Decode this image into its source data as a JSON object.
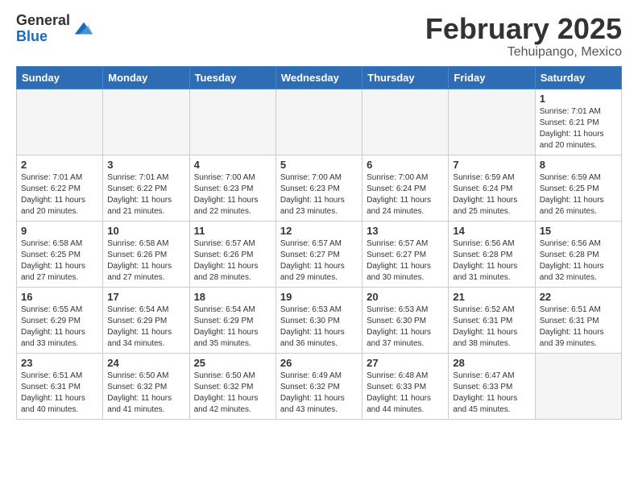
{
  "header": {
    "logo_general": "General",
    "logo_blue": "Blue",
    "month_title": "February 2025",
    "location": "Tehuipango, Mexico"
  },
  "days_of_week": [
    "Sunday",
    "Monday",
    "Tuesday",
    "Wednesday",
    "Thursday",
    "Friday",
    "Saturday"
  ],
  "weeks": [
    [
      {
        "num": "",
        "info": ""
      },
      {
        "num": "",
        "info": ""
      },
      {
        "num": "",
        "info": ""
      },
      {
        "num": "",
        "info": ""
      },
      {
        "num": "",
        "info": ""
      },
      {
        "num": "",
        "info": ""
      },
      {
        "num": "1",
        "info": "Sunrise: 7:01 AM\nSunset: 6:21 PM\nDaylight: 11 hours\nand 20 minutes."
      }
    ],
    [
      {
        "num": "2",
        "info": "Sunrise: 7:01 AM\nSunset: 6:22 PM\nDaylight: 11 hours\nand 20 minutes."
      },
      {
        "num": "3",
        "info": "Sunrise: 7:01 AM\nSunset: 6:22 PM\nDaylight: 11 hours\nand 21 minutes."
      },
      {
        "num": "4",
        "info": "Sunrise: 7:00 AM\nSunset: 6:23 PM\nDaylight: 11 hours\nand 22 minutes."
      },
      {
        "num": "5",
        "info": "Sunrise: 7:00 AM\nSunset: 6:23 PM\nDaylight: 11 hours\nand 23 minutes."
      },
      {
        "num": "6",
        "info": "Sunrise: 7:00 AM\nSunset: 6:24 PM\nDaylight: 11 hours\nand 24 minutes."
      },
      {
        "num": "7",
        "info": "Sunrise: 6:59 AM\nSunset: 6:24 PM\nDaylight: 11 hours\nand 25 minutes."
      },
      {
        "num": "8",
        "info": "Sunrise: 6:59 AM\nSunset: 6:25 PM\nDaylight: 11 hours\nand 26 minutes."
      }
    ],
    [
      {
        "num": "9",
        "info": "Sunrise: 6:58 AM\nSunset: 6:25 PM\nDaylight: 11 hours\nand 27 minutes."
      },
      {
        "num": "10",
        "info": "Sunrise: 6:58 AM\nSunset: 6:26 PM\nDaylight: 11 hours\nand 27 minutes."
      },
      {
        "num": "11",
        "info": "Sunrise: 6:57 AM\nSunset: 6:26 PM\nDaylight: 11 hours\nand 28 minutes."
      },
      {
        "num": "12",
        "info": "Sunrise: 6:57 AM\nSunset: 6:27 PM\nDaylight: 11 hours\nand 29 minutes."
      },
      {
        "num": "13",
        "info": "Sunrise: 6:57 AM\nSunset: 6:27 PM\nDaylight: 11 hours\nand 30 minutes."
      },
      {
        "num": "14",
        "info": "Sunrise: 6:56 AM\nSunset: 6:28 PM\nDaylight: 11 hours\nand 31 minutes."
      },
      {
        "num": "15",
        "info": "Sunrise: 6:56 AM\nSunset: 6:28 PM\nDaylight: 11 hours\nand 32 minutes."
      }
    ],
    [
      {
        "num": "16",
        "info": "Sunrise: 6:55 AM\nSunset: 6:29 PM\nDaylight: 11 hours\nand 33 minutes."
      },
      {
        "num": "17",
        "info": "Sunrise: 6:54 AM\nSunset: 6:29 PM\nDaylight: 11 hours\nand 34 minutes."
      },
      {
        "num": "18",
        "info": "Sunrise: 6:54 AM\nSunset: 6:29 PM\nDaylight: 11 hours\nand 35 minutes."
      },
      {
        "num": "19",
        "info": "Sunrise: 6:53 AM\nSunset: 6:30 PM\nDaylight: 11 hours\nand 36 minutes."
      },
      {
        "num": "20",
        "info": "Sunrise: 6:53 AM\nSunset: 6:30 PM\nDaylight: 11 hours\nand 37 minutes."
      },
      {
        "num": "21",
        "info": "Sunrise: 6:52 AM\nSunset: 6:31 PM\nDaylight: 11 hours\nand 38 minutes."
      },
      {
        "num": "22",
        "info": "Sunrise: 6:51 AM\nSunset: 6:31 PM\nDaylight: 11 hours\nand 39 minutes."
      }
    ],
    [
      {
        "num": "23",
        "info": "Sunrise: 6:51 AM\nSunset: 6:31 PM\nDaylight: 11 hours\nand 40 minutes."
      },
      {
        "num": "24",
        "info": "Sunrise: 6:50 AM\nSunset: 6:32 PM\nDaylight: 11 hours\nand 41 minutes."
      },
      {
        "num": "25",
        "info": "Sunrise: 6:50 AM\nSunset: 6:32 PM\nDaylight: 11 hours\nand 42 minutes."
      },
      {
        "num": "26",
        "info": "Sunrise: 6:49 AM\nSunset: 6:32 PM\nDaylight: 11 hours\nand 43 minutes."
      },
      {
        "num": "27",
        "info": "Sunrise: 6:48 AM\nSunset: 6:33 PM\nDaylight: 11 hours\nand 44 minutes."
      },
      {
        "num": "28",
        "info": "Sunrise: 6:47 AM\nSunset: 6:33 PM\nDaylight: 11 hours\nand 45 minutes."
      },
      {
        "num": "",
        "info": ""
      }
    ]
  ]
}
